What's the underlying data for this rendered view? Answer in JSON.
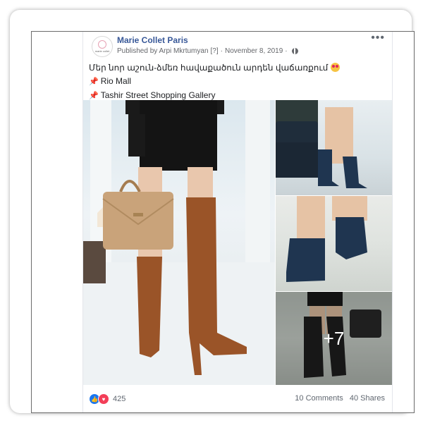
{
  "post": {
    "page_name": "Marie Collet Paris",
    "avatar_text": "marie collet",
    "published_by": "Published by Arpi Mkrtumyan",
    "help_marker": "[?]",
    "separator": "·",
    "date": "November 8, 2019",
    "caption_line1": "Մեր նոր աշուն-ձմեռ հավաքածուն արդեն վաճառքում",
    "caption_line2": "Rio Mall",
    "caption_line3": "Tashir Street Shopping Gallery",
    "more_label": "•••",
    "more_photos": "+7"
  },
  "footer": {
    "reaction_count": "425",
    "comments": "10 Comments",
    "shares": "40 Shares"
  },
  "icons": {
    "globe": "globe-icon",
    "pin": "pushpin-icon",
    "like": "like-reaction-icon",
    "love": "love-reaction-icon",
    "emoji": "heart-eyes-emoji-icon"
  },
  "colors": {
    "page_name": "#385898",
    "like": "#1877f2",
    "love": "#f33e58",
    "boots": "#9a5428",
    "bag": "#c9a37a",
    "navy_boots": "#1f3550"
  }
}
